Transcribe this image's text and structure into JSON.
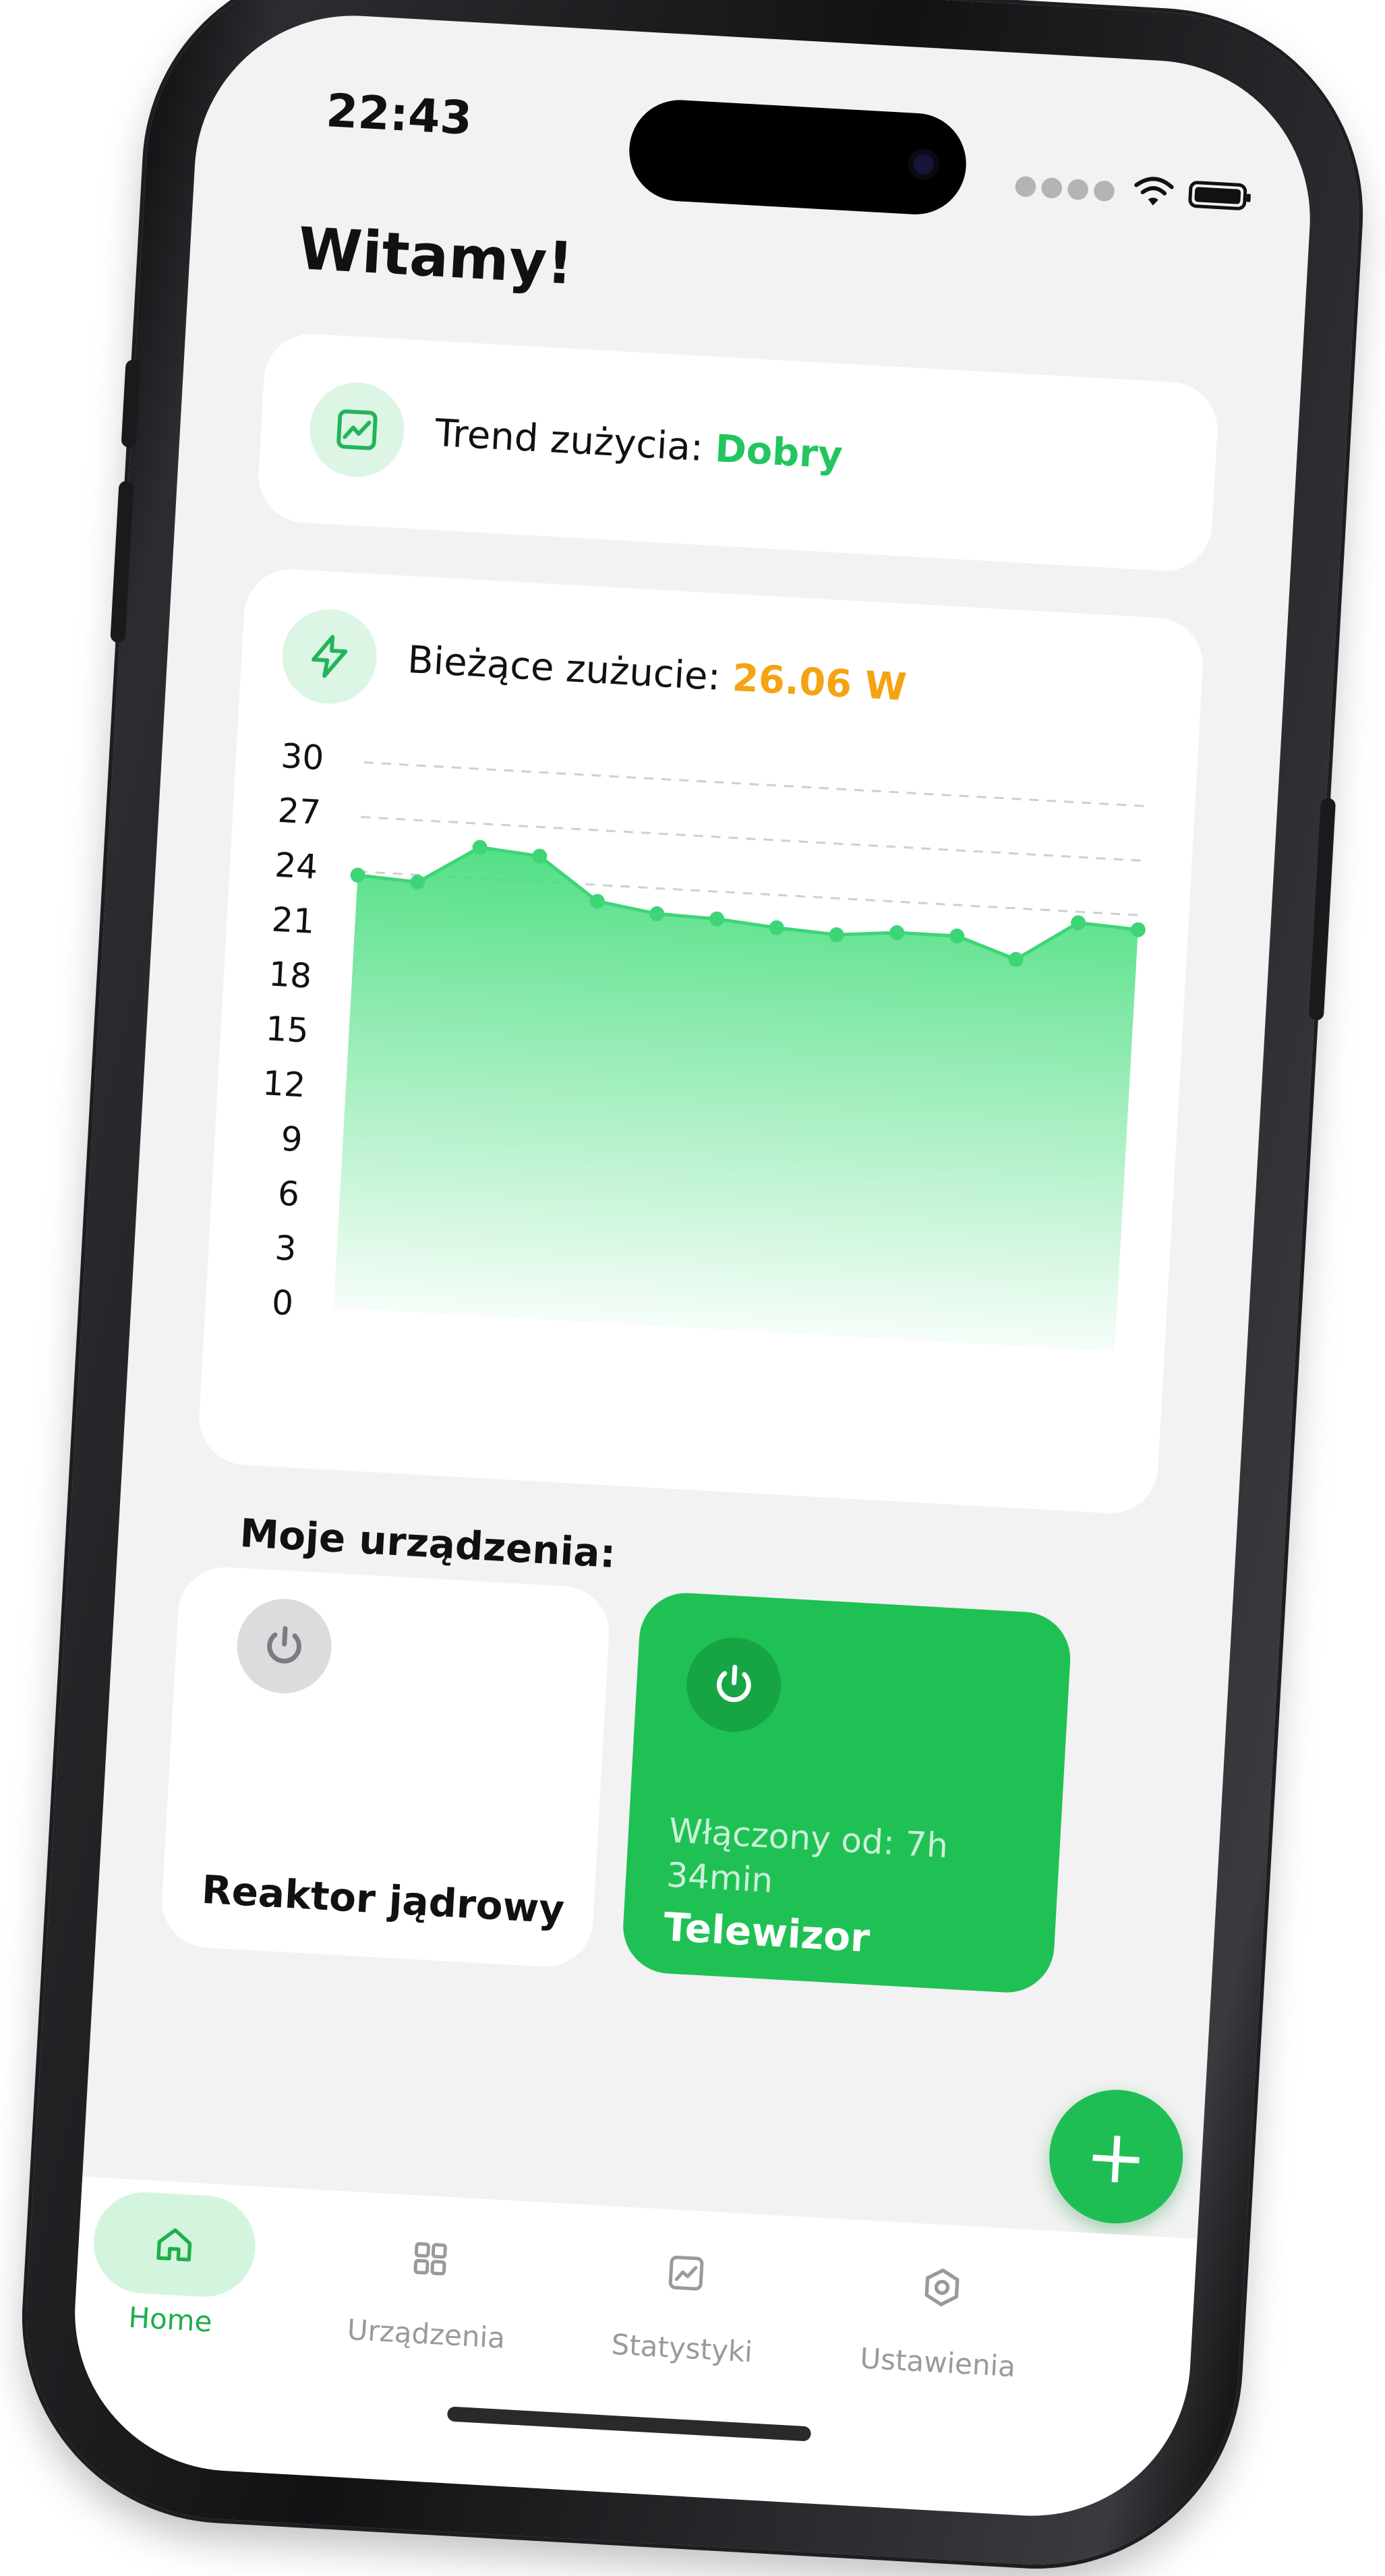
{
  "status_bar": {
    "time": "22:43"
  },
  "header": {
    "greeting": "Witamy!"
  },
  "trend_card": {
    "label": "Trend zużycia:",
    "value": "Dobry",
    "icon": "trend-chart-icon"
  },
  "usage_card": {
    "label": "Bieżące zużucie:",
    "value": "26.06 W",
    "icon": "lightning-icon"
  },
  "chart_data": {
    "type": "area",
    "y_ticks": [
      "30",
      "27",
      "24",
      "21",
      "18",
      "15",
      "12",
      "9",
      "6",
      "3",
      "0"
    ],
    "ylim": [
      0,
      30
    ],
    "values": [
      23.8,
      23.6,
      25.7,
      25.4,
      23.1,
      22.6,
      22.5,
      22.2,
      22.0,
      22.3,
      22.3,
      21.2,
      23.4,
      23.2
    ],
    "color": "#4ade80",
    "grid": "dashed lines at 30, 27, 24"
  },
  "devices_section": {
    "title": "Moje urządzenia:"
  },
  "devices": [
    {
      "name": "Reaktor jądrowy",
      "state": "off",
      "icon": "power-icon"
    },
    {
      "name": "Telewizor",
      "state": "on",
      "status": "Włączony od: 7h 34min",
      "icon": "power-icon"
    }
  ],
  "fab": {
    "label": "+",
    "icon": "plus-icon"
  },
  "tabs": [
    {
      "label": "Home",
      "icon": "home-icon",
      "active": true
    },
    {
      "label": "Urządzenia",
      "icon": "grid-icon",
      "active": false
    },
    {
      "label": "Statystyki",
      "icon": "stats-icon",
      "active": false
    },
    {
      "label": "Ustawienia",
      "icon": "settings-icon",
      "active": false
    }
  ],
  "colors": {
    "accent": "#22c55e",
    "warning": "#f5a312",
    "background": "#f2f2f2"
  }
}
